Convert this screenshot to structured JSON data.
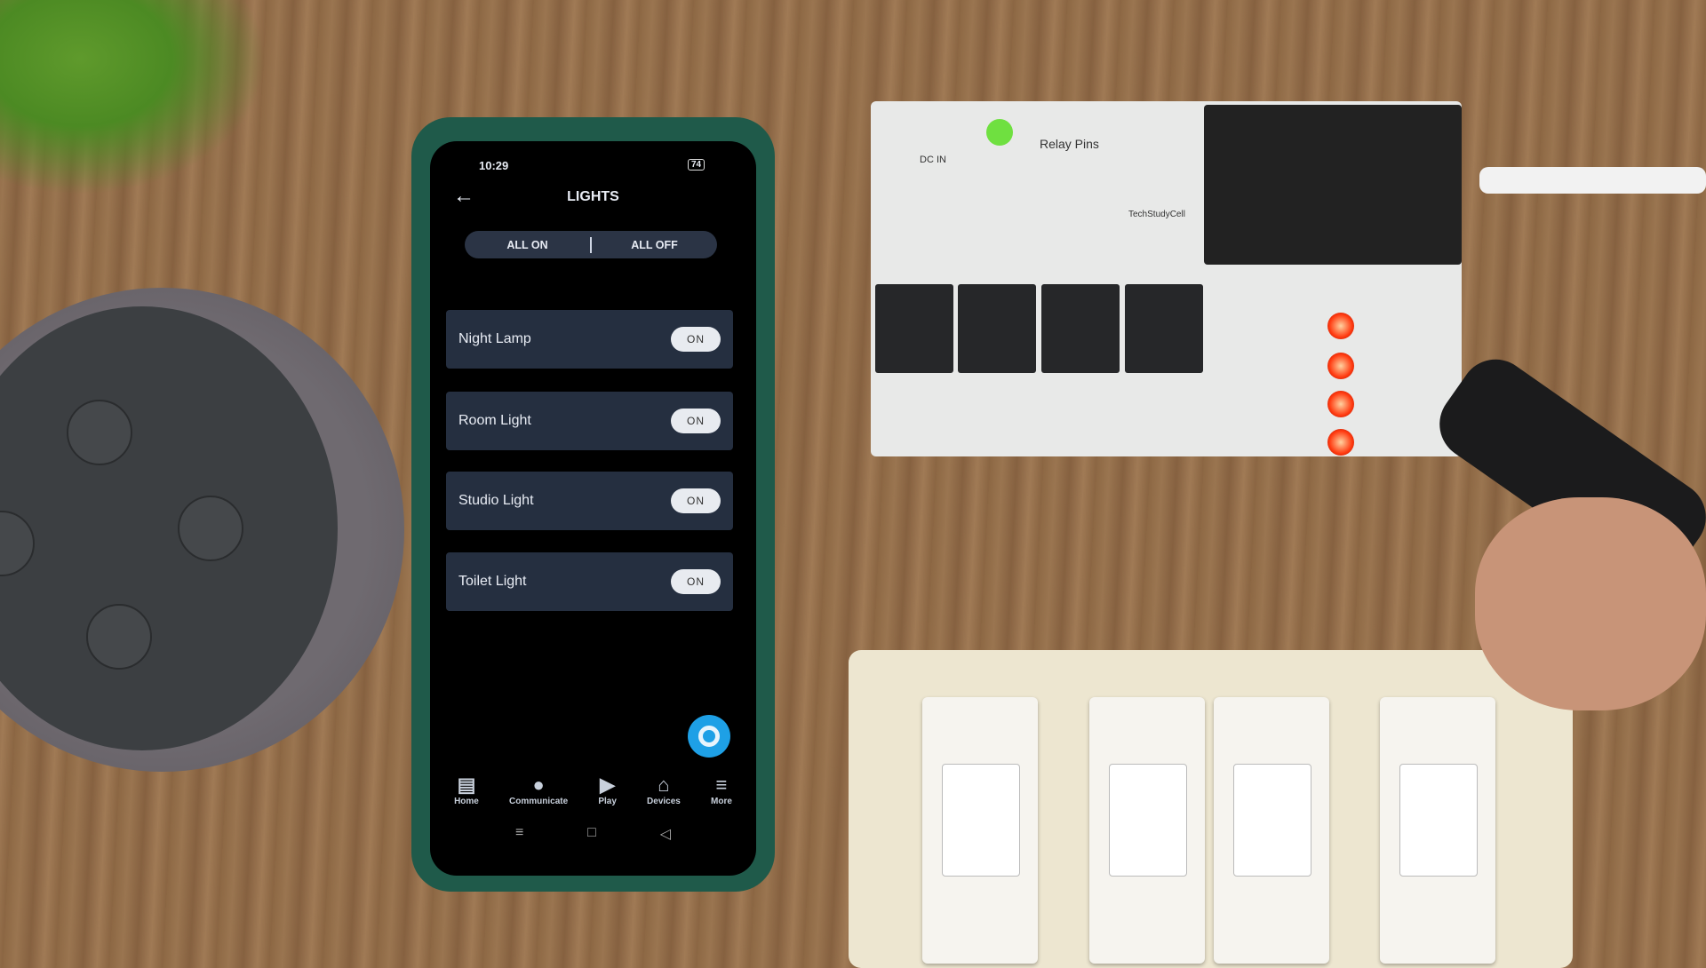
{
  "status_bar": {
    "time": "10:29",
    "battery": "74"
  },
  "header": {
    "title": "LIGHTS"
  },
  "group_controls": {
    "all_on": "ALL ON",
    "all_off": "ALL OFF"
  },
  "devices": [
    {
      "name": "Night Lamp",
      "state": "ON"
    },
    {
      "name": "Room Light",
      "state": "ON"
    },
    {
      "name": "Studio Light",
      "state": "ON"
    },
    {
      "name": "Toilet Light",
      "state": "ON"
    }
  ],
  "bottom_nav": [
    {
      "label": "Home",
      "icon": "home-icon"
    },
    {
      "label": "Communicate",
      "icon": "chat-bubble-icon"
    },
    {
      "label": "Play",
      "icon": "play-icon"
    },
    {
      "label": "Devices",
      "icon": "devices-house-icon"
    },
    {
      "label": "More",
      "icon": "menu-icon"
    }
  ],
  "board_labels": {
    "relay_pins": "Relay Pins",
    "dc_in": "DC IN",
    "brand": "TechStudyCell"
  },
  "colors": {
    "alexa_blue": "#1ea0e6",
    "card_bg": "#252f40",
    "led_red": "#ff3a10"
  }
}
